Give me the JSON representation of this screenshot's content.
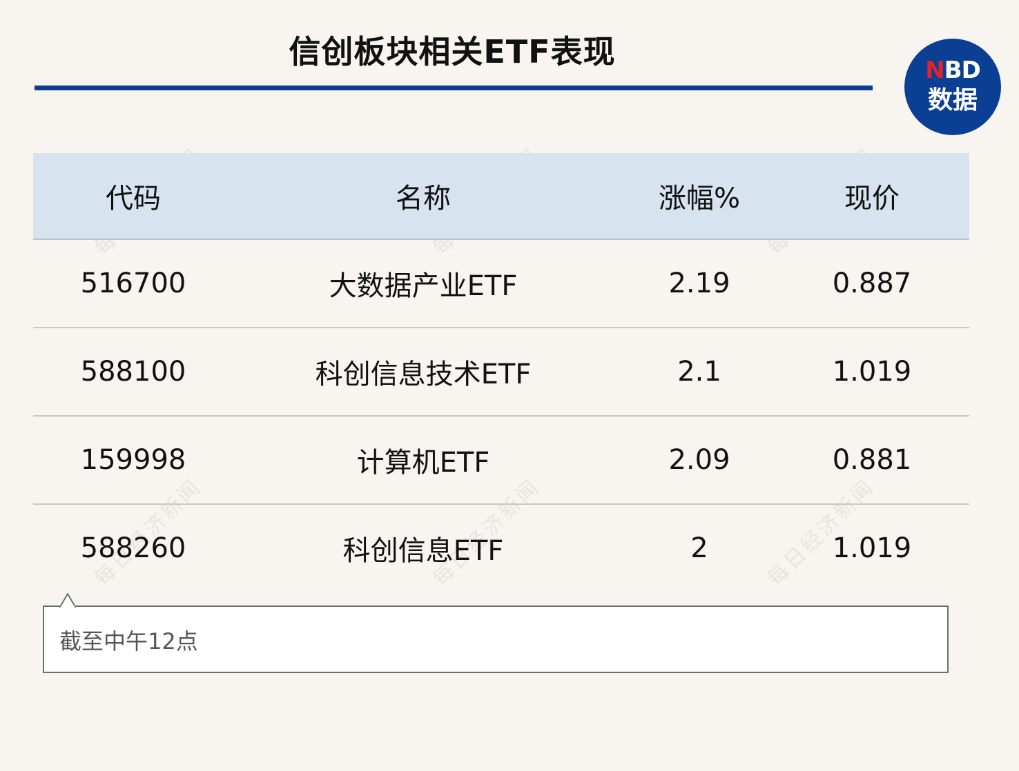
{
  "title": "信创板块相关ETF表现",
  "logo": {
    "top_red": "N",
    "top_rest": "BD",
    "bottom": "数据",
    "colors": {
      "circle": "#0b3f93",
      "red": "#e0242b"
    }
  },
  "watermark_text": "每日经济新闻",
  "table": {
    "headers": [
      "代码",
      "名称",
      "涨幅%",
      "现价"
    ],
    "rows": [
      {
        "code": "516700",
        "name": "大数据产业ETF",
        "change": "2.19",
        "price": "0.887"
      },
      {
        "code": "588100",
        "name": "科创信息技术ETF",
        "change": "2.1",
        "price": "1.019"
      },
      {
        "code": "159998",
        "name": "计算机ETF",
        "change": "2.09",
        "price": "0.881"
      },
      {
        "code": "588260",
        "name": "科创信息ETF",
        "change": "2",
        "price": "1.019"
      }
    ]
  },
  "note": "截至中午12点",
  "colors": {
    "background": "#f8f5f1",
    "accent": "#0b3f93",
    "header_bg": "#d7e3ee"
  }
}
